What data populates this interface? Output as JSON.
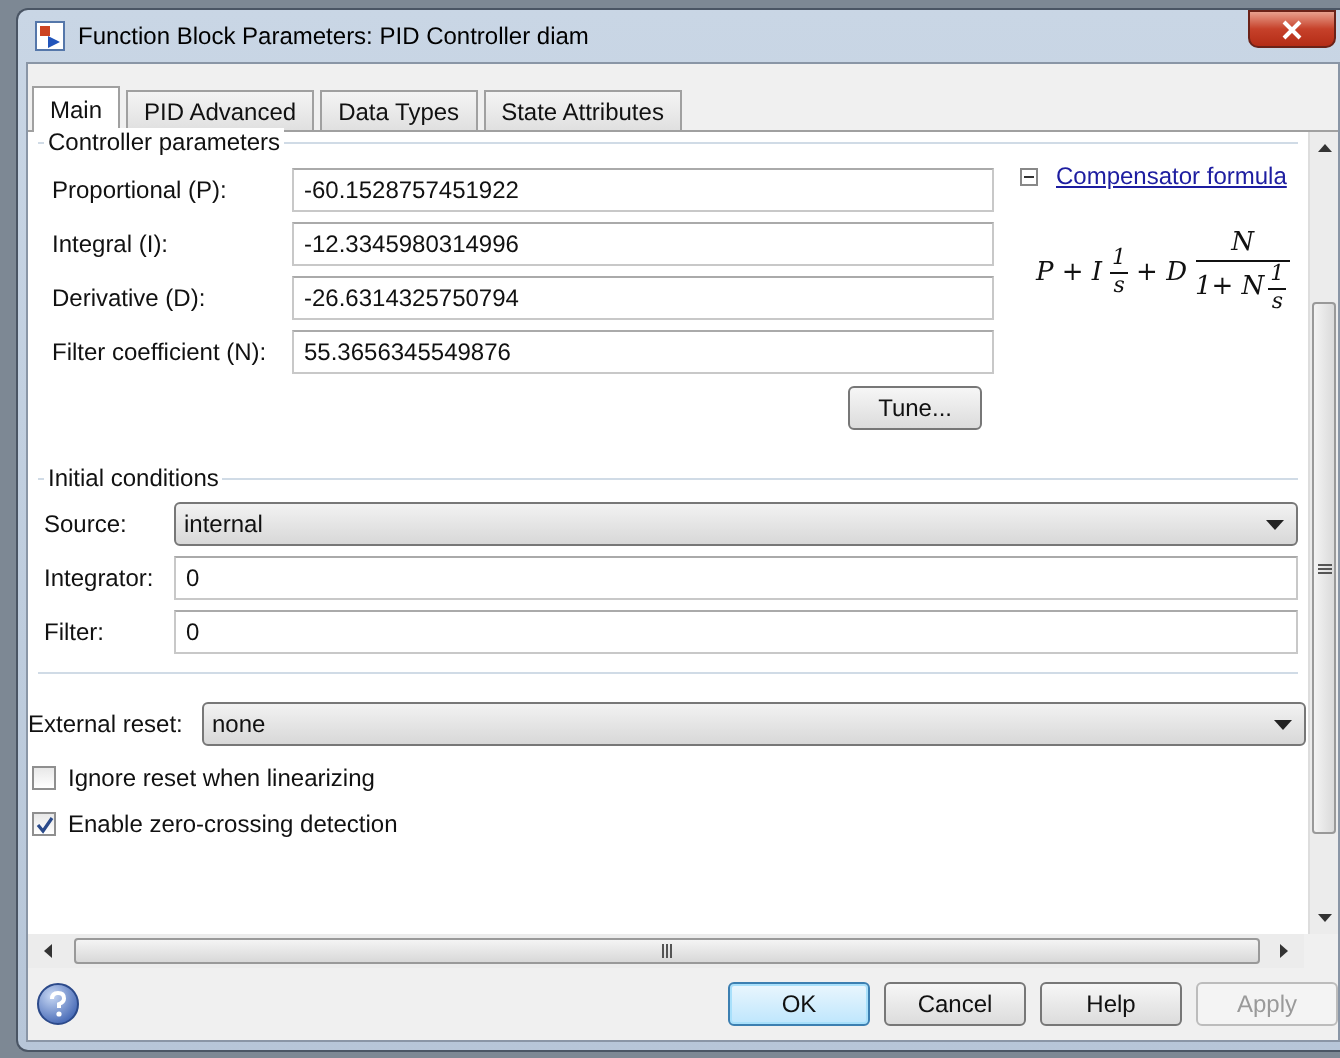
{
  "window": {
    "title": "Function Block Parameters: PID Controller diam"
  },
  "tabs": [
    {
      "label": "Main",
      "selected": true
    },
    {
      "label": "PID Advanced",
      "selected": false
    },
    {
      "label": "Data Types",
      "selected": false
    },
    {
      "label": "State Attributes",
      "selected": false
    }
  ],
  "controller_parameters": {
    "title": "Controller parameters",
    "fields": [
      {
        "label": "Proportional (P):",
        "value": "-60.1528757451922"
      },
      {
        "label": "Integral (I):",
        "value": "-12.3345980314996"
      },
      {
        "label": "Derivative (D):",
        "value": "-26.6314325750794"
      },
      {
        "label": "Filter coefficient (N):",
        "value": "55.3656345549876"
      }
    ],
    "tune_button": "Tune...",
    "compensator": {
      "expanded": true,
      "link": "Compensator formula",
      "formula": {
        "lead": "P + I",
        "i_num": "1",
        "i_den": "s",
        "mid": "+ D",
        "d_num": "N",
        "d_den": "1+ N",
        "n_num": "1",
        "n_den": "s"
      }
    }
  },
  "initial_conditions": {
    "title": "Initial conditions",
    "rows": [
      {
        "kind": "dropdown",
        "label": "Source:",
        "value": "internal"
      },
      {
        "kind": "text",
        "label": "Integrator:",
        "value": "0"
      },
      {
        "kind": "text",
        "label": "Filter:",
        "value": "0"
      }
    ]
  },
  "external_reset": {
    "label": "External reset:",
    "value": "none"
  },
  "options": [
    {
      "label": "Ignore reset when linearizing",
      "checked": false
    },
    {
      "label": "Enable zero-crossing detection",
      "checked": true
    }
  ],
  "buttons": [
    {
      "label": "OK",
      "default": true,
      "disabled": false
    },
    {
      "label": "Cancel",
      "default": false,
      "disabled": false
    },
    {
      "label": "Help",
      "default": false,
      "disabled": false
    },
    {
      "label": "Apply",
      "default": false,
      "disabled": true
    }
  ]
}
